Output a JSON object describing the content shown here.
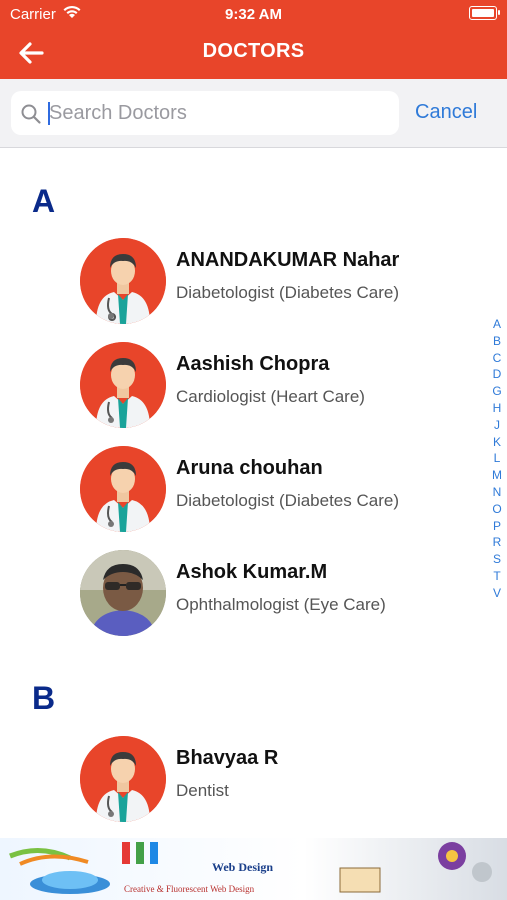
{
  "status_bar": {
    "carrier": "Carrier",
    "time": "9:32 AM"
  },
  "header": {
    "title": "DOCTORS",
    "back_icon": "arrow-left-icon",
    "background": "#e8452a"
  },
  "search": {
    "placeholder": "Search Doctors",
    "value": "",
    "cancel_label": "Cancel"
  },
  "sections": [
    {
      "letter": "A",
      "doctors": [
        {
          "name": "ANANDAKUMAR Nahar",
          "specialty": "Diabetologist (Diabetes Care)",
          "avatar": "doctor-illustration"
        },
        {
          "name": "Aashish Chopra",
          "specialty": "Cardiologist (Heart Care)",
          "avatar": "doctor-illustration"
        },
        {
          "name": "Aruna chouhan",
          "specialty": "Diabetologist (Diabetes Care)",
          "avatar": "doctor-illustration"
        },
        {
          "name": "Ashok Kumar.M",
          "specialty": "Ophthalmologist (Eye Care)",
          "avatar": "photo"
        }
      ]
    },
    {
      "letter": "B",
      "doctors": [
        {
          "name": "Bhavyaa R",
          "specialty": "Dentist",
          "avatar": "doctor-illustration"
        }
      ]
    }
  ],
  "index_letters": [
    "A",
    "B",
    "C",
    "D",
    "G",
    "H",
    "J",
    "K",
    "L",
    "M",
    "N",
    "O",
    "P",
    "R",
    "S",
    "T",
    "V"
  ],
  "banner": {
    "title": "Web Design",
    "tagline": "Creative & Fluorescent Web Design"
  },
  "colors": {
    "accent": "#e8452a",
    "link": "#2f7ad8",
    "section_letter": "#0a2a8a"
  }
}
